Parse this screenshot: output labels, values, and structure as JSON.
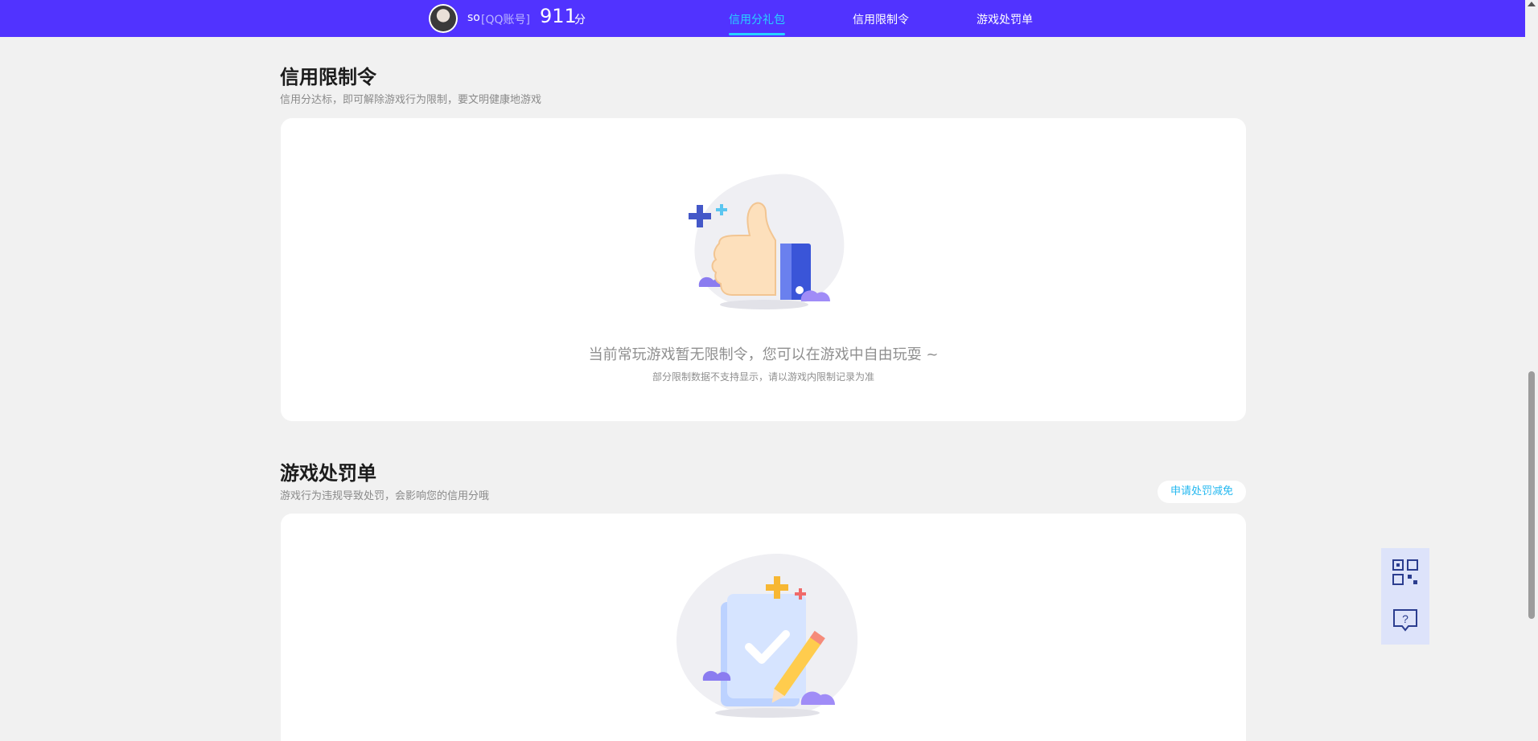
{
  "header": {
    "username": "so",
    "account_type": "[QQ账号]",
    "score": "911",
    "score_unit": "分",
    "tabs": [
      {
        "label": "信用分礼包",
        "active": true
      },
      {
        "label": "信用限制令",
        "active": false
      },
      {
        "label": "游戏处罚单",
        "active": false
      }
    ]
  },
  "restriction": {
    "title": "信用限制令",
    "subtitle": "信用分达标，即可解除游戏行为限制，要文明健康地游戏",
    "empty_title": "当前常玩游戏暂无限制令，您可以在游戏中自由玩耍 ~",
    "empty_note": "部分限制数据不支持显示，请以游戏内限制记录为准"
  },
  "penalty": {
    "title": "游戏处罚单",
    "subtitle": "游戏行为违规导致处罚，会影响您的信用分哦",
    "apply_button": "申请处罚减免"
  },
  "colors": {
    "header_bg": "#5133ff",
    "active_tab": "#27d3ff",
    "accent_link": "#24b8f0",
    "page_bg": "#f1f1f1"
  },
  "icons": {
    "thumbs_up": "thumbs-up-illustration",
    "checklist": "checklist-illustration",
    "qr": "qr-code-icon",
    "help": "help-chat-icon"
  }
}
